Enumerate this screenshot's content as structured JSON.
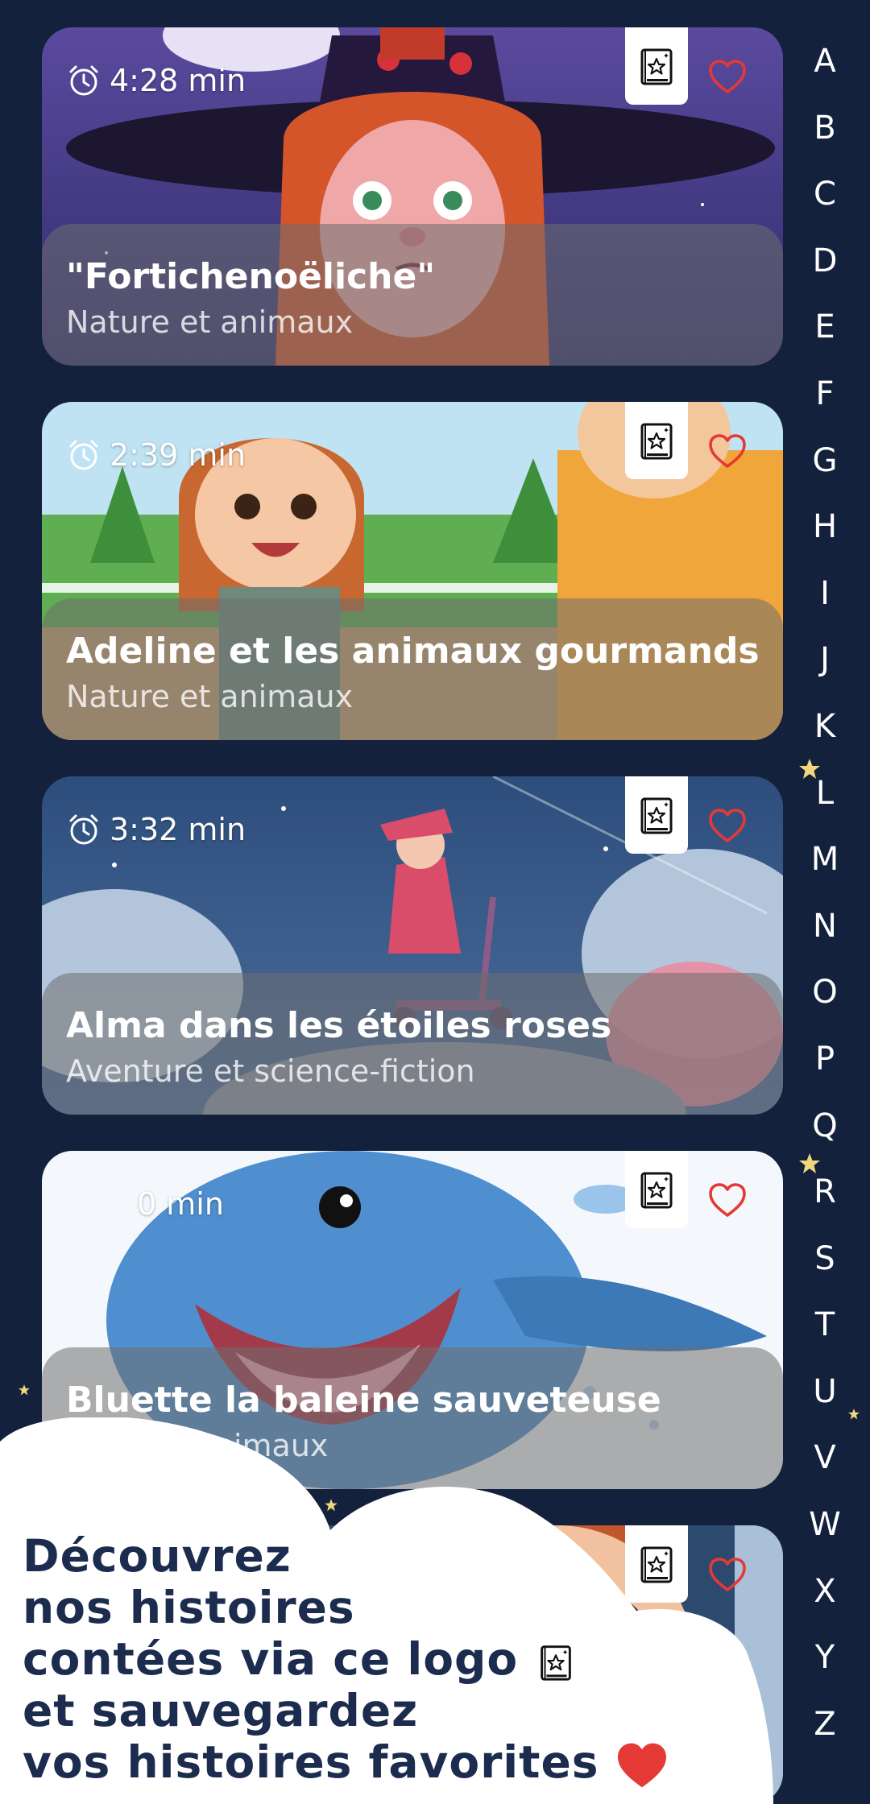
{
  "stories": [
    {
      "duration": "4:28 min",
      "title": "\"Fortichenoëliche\"",
      "category": "Nature et animaux"
    },
    {
      "duration": "2:39 min",
      "title": "Adeline et les animaux gourmands",
      "category": "Nature et animaux"
    },
    {
      "duration": "3:32 min",
      "title": "Alma dans les étoiles roses",
      "category": "Aventure et science-fiction"
    },
    {
      "duration": "0 min",
      "title": "Bluette la baleine sauveteuse",
      "category": "re et animaux"
    },
    {
      "duration": "",
      "title": "",
      "category": ""
    }
  ],
  "alphabet": [
    "A",
    "B",
    "C",
    "D",
    "E",
    "F",
    "G",
    "H",
    "I",
    "J",
    "K",
    "L",
    "M",
    "N",
    "O",
    "P",
    "Q",
    "R",
    "S",
    "T",
    "U",
    "V",
    "W",
    "X",
    "Y",
    "Z"
  ],
  "promo": {
    "line1": "Découvrez",
    "line2": "nos histoires",
    "line3": "contées via ce logo",
    "line4": "et sauvegardez",
    "line5": "vos histoires favorites"
  },
  "colors": {
    "background": "#14213d",
    "heart": "#e53935",
    "promo_text": "#1c2c4e"
  },
  "icons": {
    "time": "alarm-clock-icon",
    "story": "storybook-icon",
    "favorite": "heart-outline-icon"
  }
}
